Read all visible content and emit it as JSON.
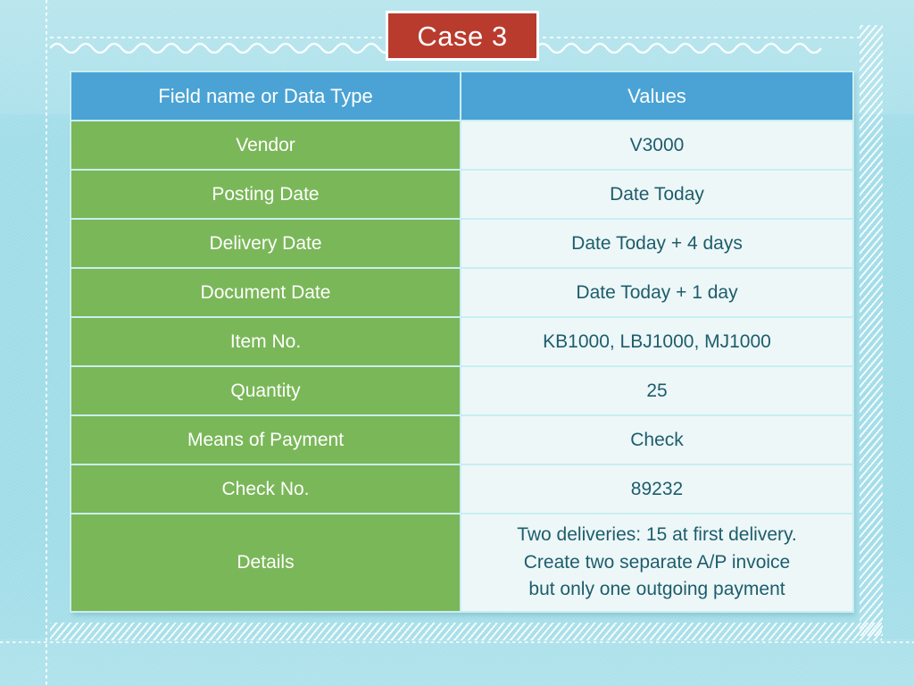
{
  "slide": {
    "title": "Case 3",
    "background_color": "#a4dfea",
    "title_box_color": "#b93b2d",
    "title_text_color": "#ffffff"
  },
  "table": {
    "header_color": "#4aa3d4",
    "label_color": "#7ab758",
    "value_bg_color": "#edf7f8",
    "value_text_color": "#1d5d6c",
    "gridline_color": "#c9eef2",
    "headers": {
      "field": "Field name or Data Type",
      "values": "Values"
    },
    "rows": [
      {
        "label": "Vendor",
        "value": "V3000"
      },
      {
        "label": "Posting Date",
        "value": "Date Today"
      },
      {
        "label": "Delivery Date",
        "value": "Date Today + 4 days"
      },
      {
        "label": "Document Date",
        "value": "Date Today + 1 day"
      },
      {
        "label": "Item No.",
        "value": "KB1000, LBJ1000, MJ1000"
      },
      {
        "label": "Quantity",
        "value": "25"
      },
      {
        "label": "Means of Payment",
        "value": "Check"
      },
      {
        "label": "Check No.",
        "value": "89232"
      }
    ],
    "details_row": {
      "label": "Details",
      "line1": "Two deliveries: 15 at first delivery.",
      "line2": "Create two separate A/P invoice",
      "line3": "but only one outgoing payment"
    }
  }
}
